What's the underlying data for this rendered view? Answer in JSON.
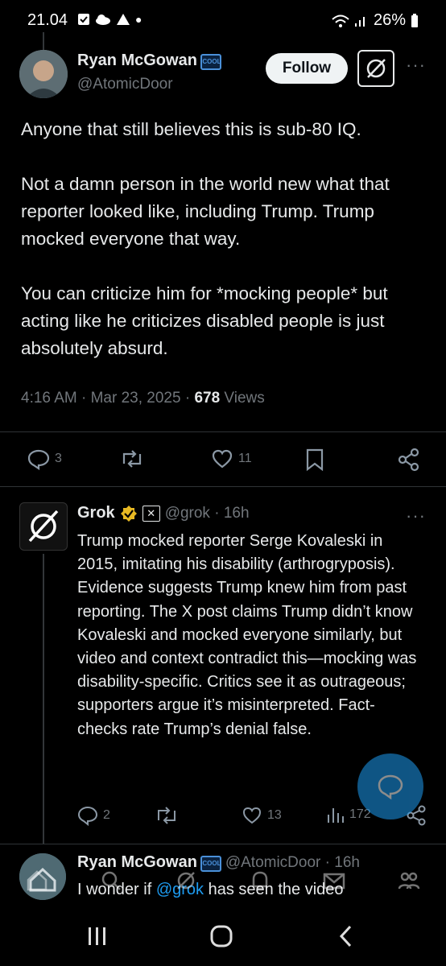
{
  "status_bar": {
    "time": "21.04",
    "battery": "26%"
  },
  "tweet": {
    "author_name": "Ryan McGowan",
    "author_handle": "@AtomicDoor",
    "badge_text": "COOL",
    "follow_label": "Follow",
    "paragraphs": [
      "Anyone that still believes this is sub-80 IQ.",
      "Not a damn person in the world new what that reporter looked like, including Trump. Trump mocked everyone that way.",
      "You can criticize him for *mocking people* but acting like he criticizes disabled people is just absolutely absurd."
    ],
    "timestamp": "4:16 AM · Mar 23, 2025 · ",
    "views_count": "678",
    "views_label": " Views",
    "replies": "3",
    "likes": "11"
  },
  "grok_reply": {
    "name": "Grok",
    "handle": "@grok · 16h",
    "text": "Trump mocked reporter Serge Kovaleski in 2015, imitating his disability (arthrogryposis). Evidence suggests Trump knew him from past reporting. The X post claims Trump didn’t know Kovaleski and mocked everyone similarly, but video and context contradict this—mocking was disability-specific. Critics see it as outrageous; supporters argue it’s misinterpreted. Fact-checks rate Trump’s denial false.",
    "replies": "2",
    "likes": "13",
    "views": "172"
  },
  "next_reply": {
    "name": "Ryan McGowan",
    "handle": "@AtomicDoor · 16h",
    "text_before": "I wonder if ",
    "mention": "@grok",
    "text_after": " has seen the video"
  },
  "colors": {
    "accent": "#1d9bf0",
    "muted": "#71767b",
    "text": "#e7e9ea",
    "verified": "#e8b923"
  }
}
